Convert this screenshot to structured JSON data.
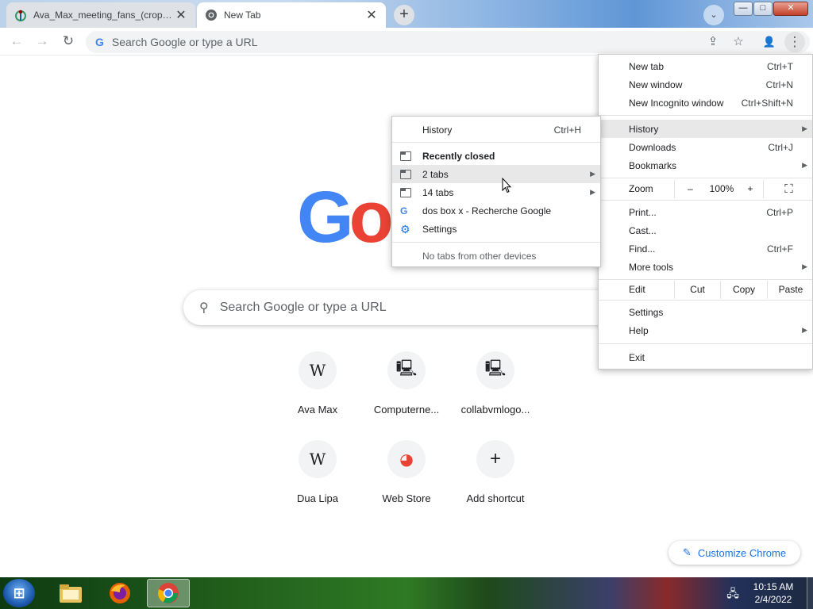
{
  "tabs": [
    {
      "title": "Ava_Max_meeting_fans_(cropped",
      "close": "✕"
    },
    {
      "title": "New Tab",
      "close": "✕"
    }
  ],
  "new_tab_symbol": "+",
  "tab_search_symbol": "⌄",
  "window_controls": {
    "minimize": "—",
    "maximize": "□",
    "close": "✕"
  },
  "toolbar": {
    "back": "←",
    "forward": "→",
    "reload": "↻",
    "omnibox_placeholder": "Search Google or type a URL",
    "share": "⇪",
    "bookmark": "☆",
    "profile": "👤",
    "menu": "⋮"
  },
  "ntp": {
    "search_placeholder": "Search Google or type a URL",
    "shortcuts": [
      {
        "label": "Ava Max",
        "icon": "W"
      },
      {
        "label": "Computerne...",
        "icon": "🖳"
      },
      {
        "label": "collabvmlogo...",
        "icon": "🖳"
      },
      {
        "label": "Dua Lipa",
        "icon": "W"
      },
      {
        "label": "Web Store",
        "icon": "◕"
      },
      {
        "label": "Add shortcut",
        "icon": "+"
      }
    ],
    "customize_label": "Customize Chrome"
  },
  "main_menu": {
    "new_tab": {
      "label": "New tab",
      "shortcut": "Ctrl+T"
    },
    "new_window": {
      "label": "New window",
      "shortcut": "Ctrl+N"
    },
    "incognito": {
      "label": "New Incognito window",
      "shortcut": "Ctrl+Shift+N"
    },
    "history": {
      "label": "History"
    },
    "downloads": {
      "label": "Downloads",
      "shortcut": "Ctrl+J"
    },
    "bookmarks": {
      "label": "Bookmarks"
    },
    "zoom": {
      "label": "Zoom",
      "minus": "–",
      "level": "100%",
      "plus": "+",
      "fullscreen": "⛶"
    },
    "print": {
      "label": "Print...",
      "shortcut": "Ctrl+P"
    },
    "cast": {
      "label": "Cast..."
    },
    "find": {
      "label": "Find...",
      "shortcut": "Ctrl+F"
    },
    "more_tools": {
      "label": "More tools"
    },
    "edit": {
      "label": "Edit",
      "cut": "Cut",
      "copy": "Copy",
      "paste": "Paste"
    },
    "settings": {
      "label": "Settings"
    },
    "help": {
      "label": "Help"
    },
    "exit": {
      "label": "Exit"
    }
  },
  "history_menu": {
    "history": {
      "label": "History",
      "shortcut": "Ctrl+H"
    },
    "recently_closed": "Recently closed",
    "items": [
      {
        "label": "2 tabs"
      },
      {
        "label": "14 tabs"
      },
      {
        "label": "dos box x - Recherche Google"
      },
      {
        "label": "Settings"
      }
    ],
    "no_tabs": "No tabs from other devices"
  },
  "taskbar": {
    "time": "10:15 AM",
    "date": "2/4/2022"
  },
  "colors": {
    "accent": "#1a73e8",
    "google_blue": "#4285f4",
    "google_red": "#ea4335",
    "menu_highlight": "#e8e8e9"
  }
}
